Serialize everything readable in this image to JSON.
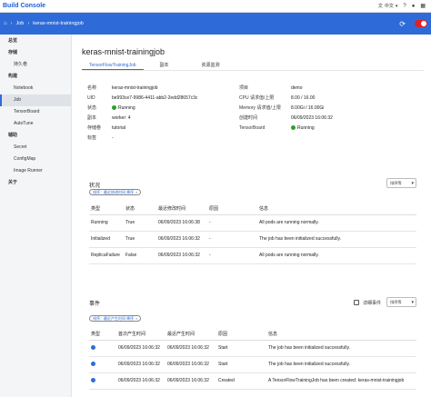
{
  "app": {
    "title": "Build Console"
  },
  "topbar": {
    "lang_label": "中文"
  },
  "breadcrumb": {
    "current": "keras-mnist-trainingjob"
  },
  "sidebar": {
    "sections": [
      {
        "label": "总览",
        "items": []
      },
      {
        "label": "存储",
        "items": [
          "持久卷"
        ]
      },
      {
        "label": "构建",
        "items": [
          "Notebook",
          "Job",
          "TensorBoard",
          "AutoTune"
        ]
      },
      {
        "label": "辅助",
        "items": [
          "Secret",
          "ConfigMap",
          "Image Runner"
        ]
      },
      {
        "label": "关于",
        "items": []
      }
    ],
    "active_item": "Job"
  },
  "page": {
    "title": "keras-mnist-trainingjob",
    "tabs": [
      "TensorFlowTrainingJob",
      "副本",
      "资源监测"
    ]
  },
  "details": {
    "left": [
      {
        "k": "名称",
        "v": "keras-mnist-trainingjob"
      },
      {
        "k": "UID",
        "v": "be993ce7-9986-4411-abb2-2edd28657c3c"
      },
      {
        "k": "状态",
        "v": "Running"
      },
      {
        "k": "副本",
        "v": "worker: 4"
      },
      {
        "k": "存储卷",
        "v": "tutorial"
      },
      {
        "k": "标签",
        "v": "-"
      }
    ],
    "right": [
      {
        "k": "项目",
        "v": "demo"
      },
      {
        "k": "CPU 请求值/上限",
        "v": "8.00 / 16.00"
      },
      {
        "k": "Memory 请求值/上限",
        "v": "8.00Gi / 16.00Gi"
      },
      {
        "k": "创建时间",
        "v": "06/09/2023 16:06:32"
      },
      {
        "k": "TensorBoard",
        "v": "Running"
      }
    ]
  },
  "status_section": {
    "title": "状况",
    "sort_label": "排序等",
    "chip_label": "排序：最近修改时间 降序",
    "columns": [
      "类型",
      "状态",
      "最近修改时间",
      "原因",
      "信息"
    ],
    "rows": [
      [
        "Running",
        "True",
        "06/09/2023 16:06:38",
        "-",
        "All pods are running normally."
      ],
      [
        "Initialized",
        "True",
        "06/09/2023 16:06:32",
        "-",
        "The job has been initialized successfully."
      ],
      [
        "ReplicaFailure",
        "False",
        "06/09/2023 16:06:32",
        "-",
        "All pods are running normally."
      ]
    ]
  },
  "events_section": {
    "title": "事件",
    "detail_label": "详细事件",
    "sort_label": "排序等",
    "chip_label": "排序：最近产生时间 降序",
    "columns": [
      "类型",
      "首次产生时间",
      "最近产生时间",
      "原因",
      "信息"
    ],
    "rows": [
      [
        "",
        "06/09/2023 16:06:32",
        "06/09/2023 16:06:32",
        "Start",
        "The job has been initialized successfully."
      ],
      [
        "",
        "06/09/2023 16:06:32",
        "06/09/2023 16:06:32",
        "Start",
        "The job has been initialized successfully."
      ],
      [
        "",
        "06/09/2023 16:06:32",
        "06/09/2023 16:06:32",
        "Created",
        "A TensorFlowTrainingJob has been created: keras-mnist-trainingjob"
      ]
    ]
  },
  "colors": {
    "primary": "#2f6bd8",
    "running": "#2ba02b",
    "danger": "#e02020"
  }
}
